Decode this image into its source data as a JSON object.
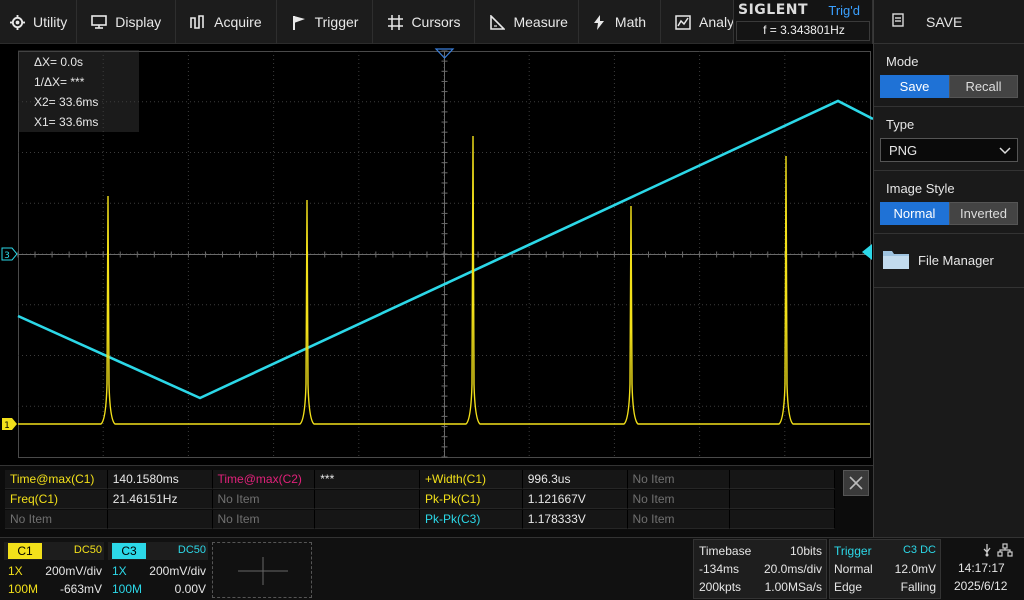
{
  "menu": [
    {
      "label": "Utility",
      "icon": "gear-icon"
    },
    {
      "label": "Display",
      "icon": "monitor-icon"
    },
    {
      "label": "Acquire",
      "icon": "acquire-icon"
    },
    {
      "label": "Trigger",
      "icon": "flag-icon"
    },
    {
      "label": "Cursors",
      "icon": "crosshair-icon"
    },
    {
      "label": "Measure",
      "icon": "ruler-icon"
    },
    {
      "label": "Math",
      "icon": "lightning-icon"
    },
    {
      "label": "Analysis",
      "icon": "analysis-icon"
    }
  ],
  "brand": {
    "name": "SIGLENT",
    "trig_status": "Trig'd",
    "frequency": "f = 3.343801Hz"
  },
  "side_panel": {
    "title": "SAVE",
    "mode": {
      "label": "Mode",
      "options": [
        "Save",
        "Recall"
      ],
      "selected": "Save"
    },
    "type": {
      "label": "Type",
      "value": "PNG"
    },
    "image_style": {
      "label": "Image Style",
      "options": [
        "Normal",
        "Inverted"
      ],
      "selected": "Normal"
    },
    "file_manager": "File Manager"
  },
  "cursor_readout": {
    "dx": "ΔX= 0.0s",
    "inv_dx": "1/ΔX= ***",
    "x2": "X2= 33.6ms",
    "x1": "X1= 33.6ms"
  },
  "channel_markers": {
    "c3": "3",
    "c1": "1"
  },
  "colors": {
    "c1": "#f2e01a",
    "c2": "#e0217a",
    "c3": "#2cd8e8",
    "accent": "#1f72d6",
    "grid": "#3c3c3c"
  },
  "measurements": [
    [
      {
        "label": "Time@max(C1)",
        "value": "140.1580ms",
        "color": "yellow"
      },
      {
        "label": "Time@max(C2)",
        "value": "***",
        "color": "pink"
      },
      {
        "label": "+Width(C1)",
        "value": "996.3us",
        "color": "yellow"
      },
      {
        "label": "No Item",
        "value": "",
        "color": "gray"
      }
    ],
    [
      {
        "label": "Freq(C1)",
        "value": "21.46151Hz",
        "color": "yellow"
      },
      {
        "label": "No Item",
        "value": "",
        "color": "gray"
      },
      {
        "label": "Pk-Pk(C1)",
        "value": "1.121667V",
        "color": "yellow"
      },
      {
        "label": "No Item",
        "value": "",
        "color": "gray"
      }
    ],
    [
      {
        "label": "No Item",
        "value": "",
        "color": "gray"
      },
      {
        "label": "No Item",
        "value": "",
        "color": "gray"
      },
      {
        "label": "Pk-Pk(C3)",
        "value": "1.178333V",
        "color": "cyan"
      },
      {
        "label": "No Item",
        "value": "",
        "color": "gray"
      }
    ]
  ],
  "channels": {
    "c1": {
      "name": "C1",
      "coupling": "DC50",
      "probe": "1X",
      "scale": "200mV/div",
      "bw": "100M",
      "offset": "-663mV"
    },
    "c3": {
      "name": "C3",
      "coupling": "DC50",
      "probe": "1X",
      "scale": "200mV/div",
      "bw": "100M",
      "offset": "0.00V"
    }
  },
  "timebase": {
    "label": "Timebase",
    "bits": "10bits",
    "delay": "-134ms",
    "scale": "20.0ms/div",
    "points": "200kpts",
    "rate": "1.00MSa/s"
  },
  "trigger": {
    "label": "Trigger",
    "source": "C3 DC",
    "mode": "Normal",
    "level": "12.0mV",
    "type": "Edge",
    "slope": "Falling"
  },
  "clock": {
    "time": "14:17:17",
    "date": "2025/6/12"
  }
}
